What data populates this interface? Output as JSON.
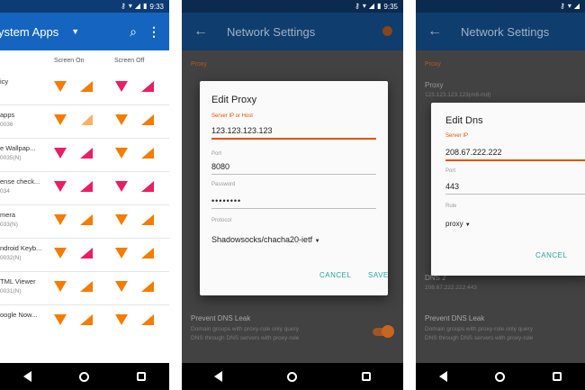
{
  "status": {
    "time1": "9:33",
    "time2": "9:35"
  },
  "panel1": {
    "title": "ystem Apps",
    "col_screen_on": "Screen On",
    "col_screen_off": "Screen Off",
    "rows": [
      {
        "name": "icy",
        "sub": ""
      },
      {
        "name": "apps",
        "sub": "0036"
      },
      {
        "name": "e Wallpap...",
        "sub": "0035(N)"
      },
      {
        "name": "ense check...",
        "sub": "034"
      },
      {
        "name": "mera",
        "sub": "033(N)"
      },
      {
        "name": "ndroid Keyb...",
        "sub": "0032(N)"
      },
      {
        "name": "TML Viewer",
        "sub": "0031(N)"
      },
      {
        "name": "oogle Now...",
        "sub": ""
      }
    ]
  },
  "panel2": {
    "title": "Network Settings",
    "bg_proxy_label": "Proxy",
    "bg_dns_leak_title": "Prevent DNS Leak",
    "bg_dns_leak_sub1": "Domain groups with proxy-rule only query",
    "bg_dns_leak_sub2": "DNS through DNS servers with proxy-rule",
    "dialog": {
      "title": "Edit Proxy",
      "label_server": "Server IP or Host",
      "server": "123.123.123.123",
      "label_port": "Port",
      "port": "8080",
      "label_password": "Password",
      "password": "••••••••",
      "label_protocol": "Protocol",
      "protocol": "Shadowsocks/chacha20-ietf",
      "cancel": "CANCEL",
      "save": "SAVE"
    }
  },
  "panel3": {
    "title": "Network Settings",
    "bg_proxy_label": "Proxy",
    "bg_proxy_title": "Proxy",
    "bg_proxy_value": "123.123.123.123(m8-md)",
    "bg_dns2": "DNS 2",
    "bg_dns2_value": "208.67.222.222:443",
    "bg_dns_leak_title": "Prevent DNS Leak",
    "bg_dns_leak_sub1": "Domain groups with proxy-rule only query",
    "bg_dns_leak_sub2": "DNS through DNS servers with proxy-rule",
    "dialog": {
      "title": "Edit Dns",
      "label_server": "Server IP",
      "server": "208.67.222.222",
      "label_port": "Port",
      "port": "443",
      "label_rule": "Rule",
      "rule": "proxy",
      "cancel": "CANCEL"
    }
  }
}
